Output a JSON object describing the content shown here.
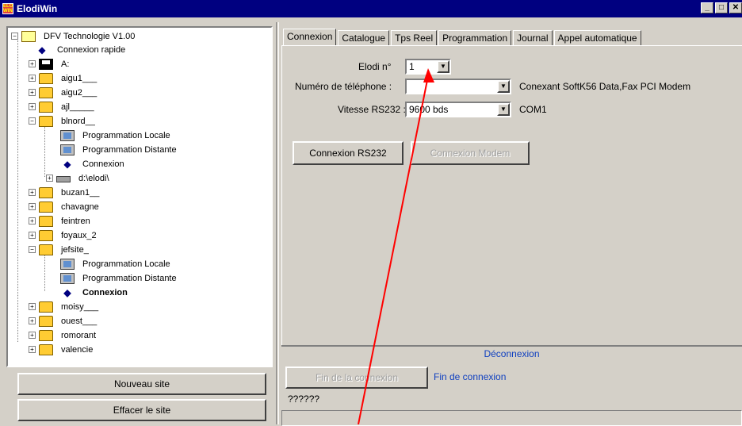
{
  "window": {
    "title": "ElodiWin"
  },
  "tree": {
    "root": "DFV Technologie V1.00",
    "nodes": [
      {
        "label": "Connexion rapide",
        "bold": false
      },
      {
        "label": "A:",
        "bold": false
      },
      {
        "label": "aigu1___",
        "bold": false
      },
      {
        "label": "aigu2___",
        "bold": false
      },
      {
        "label": "ajl_____",
        "bold": false
      },
      {
        "label": "blnord__",
        "bold": false
      },
      {
        "label": "Programmation Locale",
        "bold": false
      },
      {
        "label": "Programmation Distante",
        "bold": false
      },
      {
        "label": "Connexion",
        "bold": false
      },
      {
        "label": "d:\\elodi\\",
        "bold": false
      },
      {
        "label": "buzan1__",
        "bold": false
      },
      {
        "label": "chavagne",
        "bold": false
      },
      {
        "label": "feintren",
        "bold": false
      },
      {
        "label": "foyaux_2",
        "bold": false
      },
      {
        "label": "jefsite_",
        "bold": false
      },
      {
        "label": "Programmation Locale",
        "bold": false
      },
      {
        "label": "Programmation Distante",
        "bold": false
      },
      {
        "label": "Connexion",
        "bold": true
      },
      {
        "label": "moisy___",
        "bold": false
      },
      {
        "label": "ouest___",
        "bold": false
      },
      {
        "label": "romorant",
        "bold": false
      },
      {
        "label": "valencie",
        "bold": false
      }
    ]
  },
  "left_buttons": {
    "new_site": "Nouveau site",
    "delete_site": "Effacer le site"
  },
  "tabs": [
    "Connexion",
    "Catalogue",
    "Tps Reel",
    "Programmation",
    "Journal",
    "Appel automatique"
  ],
  "connexion": {
    "elodi_label": "Elodi n°",
    "elodi_value": "1",
    "phone_label": "Numéro de téléphone :",
    "phone_value": "",
    "modem_name": "Conexant SoftK56 Data,Fax PCI Modem",
    "rs232_label": "Vitesse RS232 :",
    "rs232_value": "9600 bds",
    "com_port": "COM1",
    "btn_rs232": "Connexion RS232",
    "btn_modem": "Connexion Modem"
  },
  "deconnexion": {
    "group_label": "Déconnexion",
    "end_button": "Fin de la connexion",
    "status_text": "Fin de connexion",
    "question": "??????"
  },
  "colors": {
    "titlebar": "#000080",
    "annotation_arrow": "#ff0000",
    "link_text": "#1040c0"
  }
}
